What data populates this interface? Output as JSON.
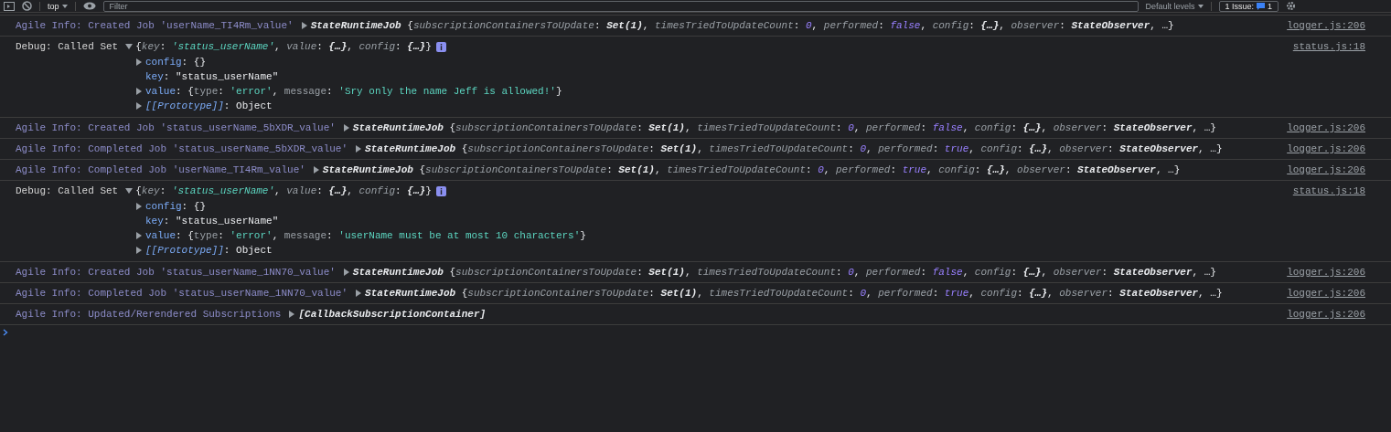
{
  "toolbar": {
    "context": "top",
    "filter_placeholder": "Filter",
    "levels": "Default levels",
    "issues_label": "1 Issue:",
    "issues_count": "1"
  },
  "messages": [
    {
      "kind": "info",
      "text": "Agile Info: Created Job 'userName_TI4Rm_value'",
      "expanded": false,
      "source": "logger.js:206",
      "preview": [
        {
          "text": "StateRuntimeJob ",
          "kind": "cls"
        },
        {
          "text": "{",
          "kind": "p"
        },
        {
          "text": "subscriptionContainersToUpdate",
          "kind": "key"
        },
        {
          "text": ": ",
          "kind": "p"
        },
        {
          "text": "Set(1)",
          "kind": "cls"
        },
        {
          "text": ", ",
          "kind": "p"
        },
        {
          "text": "timesTriedToUpdateCount",
          "kind": "key"
        },
        {
          "text": ": ",
          "kind": "p"
        },
        {
          "text": "0",
          "kind": "num"
        },
        {
          "text": ", ",
          "kind": "p"
        },
        {
          "text": "performed",
          "kind": "key"
        },
        {
          "text": ": ",
          "kind": "p"
        },
        {
          "text": "false",
          "kind": "num"
        },
        {
          "text": ", ",
          "kind": "p"
        },
        {
          "text": "config",
          "kind": "key"
        },
        {
          "text": ": ",
          "kind": "p"
        },
        {
          "text": "{…}",
          "kind": "cls"
        },
        {
          "text": ", ",
          "kind": "p"
        },
        {
          "text": "observer",
          "kind": "key"
        },
        {
          "text": ": ",
          "kind": "p"
        },
        {
          "text": "StateObserver",
          "kind": "cls"
        },
        {
          "text": ", …}",
          "kind": "p"
        }
      ]
    },
    {
      "kind": "debug",
      "text": "Debug: Called Set",
      "expanded": true,
      "source": "status.js:18",
      "preview": [
        {
          "text": "{",
          "kind": "p"
        },
        {
          "text": "key",
          "kind": "key"
        },
        {
          "text": ": ",
          "kind": "p"
        },
        {
          "text": "'status_userName'",
          "kind": "str"
        },
        {
          "text": ", ",
          "kind": "p"
        },
        {
          "text": "value",
          "kind": "key"
        },
        {
          "text": ": ",
          "kind": "p"
        },
        {
          "text": "{…}",
          "kind": "cls"
        },
        {
          "text": ", ",
          "kind": "p"
        },
        {
          "text": "config",
          "kind": "key"
        },
        {
          "text": ": ",
          "kind": "p"
        },
        {
          "text": "{…}",
          "kind": "cls"
        },
        {
          "text": "}",
          "kind": "p"
        }
      ],
      "children": [
        {
          "expanded": false,
          "tokens": [
            {
              "text": "config",
              "kind": "prop"
            },
            {
              "text": ": ",
              "kind": "p"
            },
            {
              "text": "{}",
              "kind": "p"
            }
          ]
        },
        {
          "tokens": [
            {
              "text": "key",
              "kind": "prop"
            },
            {
              "text": ": ",
              "kind": "p"
            },
            {
              "text": "\"status_userName\"",
              "kind": "p"
            }
          ]
        },
        {
          "expanded": false,
          "tokens": [
            {
              "text": "value",
              "kind": "prop"
            },
            {
              "text": ": ",
              "kind": "p"
            },
            {
              "text": "{",
              "kind": "p"
            },
            {
              "text": "type",
              "kind": "plainkey"
            },
            {
              "text": ": ",
              "kind": "p"
            },
            {
              "text": "'error'",
              "kind": "strp"
            },
            {
              "text": ", ",
              "kind": "p"
            },
            {
              "text": "message",
              "kind": "plainkey"
            },
            {
              "text": ": ",
              "kind": "p"
            },
            {
              "text": "'Sry only the name Jeff is allowed!'",
              "kind": "strp"
            },
            {
              "text": "}",
              "kind": "p"
            }
          ]
        },
        {
          "expanded": false,
          "tokens": [
            {
              "text": "[[Prototype]]",
              "kind": "proto"
            },
            {
              "text": ": ",
              "kind": "p"
            },
            {
              "text": "Object",
              "kind": "p"
            }
          ]
        }
      ]
    },
    {
      "kind": "info",
      "text": "Agile Info: Created Job 'status_userName_5bXDR_value'",
      "expanded": false,
      "source": "logger.js:206",
      "preview": [
        {
          "text": "StateRuntimeJob ",
          "kind": "cls"
        },
        {
          "text": "{",
          "kind": "p"
        },
        {
          "text": "subscriptionContainersToUpdate",
          "kind": "key"
        },
        {
          "text": ": ",
          "kind": "p"
        },
        {
          "text": "Set(1)",
          "kind": "cls"
        },
        {
          "text": ", ",
          "kind": "p"
        },
        {
          "text": "timesTriedToUpdateCount",
          "kind": "key"
        },
        {
          "text": ": ",
          "kind": "p"
        },
        {
          "text": "0",
          "kind": "num"
        },
        {
          "text": ", ",
          "kind": "p"
        },
        {
          "text": "performed",
          "kind": "key"
        },
        {
          "text": ": ",
          "kind": "p"
        },
        {
          "text": "false",
          "kind": "num"
        },
        {
          "text": ", ",
          "kind": "p"
        },
        {
          "text": "config",
          "kind": "key"
        },
        {
          "text": ": ",
          "kind": "p"
        },
        {
          "text": "{…}",
          "kind": "cls"
        },
        {
          "text": ", ",
          "kind": "p"
        },
        {
          "text": "observer",
          "kind": "key"
        },
        {
          "text": ": ",
          "kind": "p"
        },
        {
          "text": "StateObserver",
          "kind": "cls"
        },
        {
          "text": ", …}",
          "kind": "p"
        }
      ]
    },
    {
      "kind": "info",
      "text": "Agile Info: Completed Job 'status_userName_5bXDR_value'",
      "expanded": false,
      "source": "logger.js:206",
      "preview": [
        {
          "text": "StateRuntimeJob ",
          "kind": "cls"
        },
        {
          "text": "{",
          "kind": "p"
        },
        {
          "text": "subscriptionContainersToUpdate",
          "kind": "key"
        },
        {
          "text": ": ",
          "kind": "p"
        },
        {
          "text": "Set(1)",
          "kind": "cls"
        },
        {
          "text": ", ",
          "kind": "p"
        },
        {
          "text": "timesTriedToUpdateCount",
          "kind": "key"
        },
        {
          "text": ": ",
          "kind": "p"
        },
        {
          "text": "0",
          "kind": "num"
        },
        {
          "text": ", ",
          "kind": "p"
        },
        {
          "text": "performed",
          "kind": "key"
        },
        {
          "text": ": ",
          "kind": "p"
        },
        {
          "text": "true",
          "kind": "num"
        },
        {
          "text": ", ",
          "kind": "p"
        },
        {
          "text": "config",
          "kind": "key"
        },
        {
          "text": ": ",
          "kind": "p"
        },
        {
          "text": "{…}",
          "kind": "cls"
        },
        {
          "text": ", ",
          "kind": "p"
        },
        {
          "text": "observer",
          "kind": "key"
        },
        {
          "text": ": ",
          "kind": "p"
        },
        {
          "text": "StateObserver",
          "kind": "cls"
        },
        {
          "text": ", …}",
          "kind": "p"
        }
      ]
    },
    {
      "kind": "info",
      "text": "Agile Info: Completed Job 'userName_TI4Rm_value'",
      "expanded": false,
      "source": "logger.js:206",
      "preview": [
        {
          "text": "StateRuntimeJob ",
          "kind": "cls"
        },
        {
          "text": "{",
          "kind": "p"
        },
        {
          "text": "subscriptionContainersToUpdate",
          "kind": "key"
        },
        {
          "text": ": ",
          "kind": "p"
        },
        {
          "text": "Set(1)",
          "kind": "cls"
        },
        {
          "text": ", ",
          "kind": "p"
        },
        {
          "text": "timesTriedToUpdateCount",
          "kind": "key"
        },
        {
          "text": ": ",
          "kind": "p"
        },
        {
          "text": "0",
          "kind": "num"
        },
        {
          "text": ", ",
          "kind": "p"
        },
        {
          "text": "performed",
          "kind": "key"
        },
        {
          "text": ": ",
          "kind": "p"
        },
        {
          "text": "true",
          "kind": "num"
        },
        {
          "text": ", ",
          "kind": "p"
        },
        {
          "text": "config",
          "kind": "key"
        },
        {
          "text": ": ",
          "kind": "p"
        },
        {
          "text": "{…}",
          "kind": "cls"
        },
        {
          "text": ", ",
          "kind": "p"
        },
        {
          "text": "observer",
          "kind": "key"
        },
        {
          "text": ": ",
          "kind": "p"
        },
        {
          "text": "StateObserver",
          "kind": "cls"
        },
        {
          "text": ", …}",
          "kind": "p"
        }
      ]
    },
    {
      "kind": "debug",
      "text": "Debug: Called Set",
      "expanded": true,
      "source": "status.js:18",
      "preview": [
        {
          "text": "{",
          "kind": "p"
        },
        {
          "text": "key",
          "kind": "key"
        },
        {
          "text": ": ",
          "kind": "p"
        },
        {
          "text": "'status_userName'",
          "kind": "str"
        },
        {
          "text": ", ",
          "kind": "p"
        },
        {
          "text": "value",
          "kind": "key"
        },
        {
          "text": ": ",
          "kind": "p"
        },
        {
          "text": "{…}",
          "kind": "cls"
        },
        {
          "text": ", ",
          "kind": "p"
        },
        {
          "text": "config",
          "kind": "key"
        },
        {
          "text": ": ",
          "kind": "p"
        },
        {
          "text": "{…}",
          "kind": "cls"
        },
        {
          "text": "}",
          "kind": "p"
        }
      ],
      "children": [
        {
          "expanded": false,
          "tokens": [
            {
              "text": "config",
              "kind": "prop"
            },
            {
              "text": ": ",
              "kind": "p"
            },
            {
              "text": "{}",
              "kind": "p"
            }
          ]
        },
        {
          "tokens": [
            {
              "text": "key",
              "kind": "prop"
            },
            {
              "text": ": ",
              "kind": "p"
            },
            {
              "text": "\"status_userName\"",
              "kind": "p"
            }
          ]
        },
        {
          "expanded": false,
          "tokens": [
            {
              "text": "value",
              "kind": "prop"
            },
            {
              "text": ": ",
              "kind": "p"
            },
            {
              "text": "{",
              "kind": "p"
            },
            {
              "text": "type",
              "kind": "plainkey"
            },
            {
              "text": ": ",
              "kind": "p"
            },
            {
              "text": "'error'",
              "kind": "strp"
            },
            {
              "text": ", ",
              "kind": "p"
            },
            {
              "text": "message",
              "kind": "plainkey"
            },
            {
              "text": ": ",
              "kind": "p"
            },
            {
              "text": "'userName must be at most 10 characters'",
              "kind": "strp"
            },
            {
              "text": "}",
              "kind": "p"
            }
          ]
        },
        {
          "expanded": false,
          "tokens": [
            {
              "text": "[[Prototype]]",
              "kind": "proto"
            },
            {
              "text": ": ",
              "kind": "p"
            },
            {
              "text": "Object",
              "kind": "p"
            }
          ]
        }
      ]
    },
    {
      "kind": "info",
      "text": "Agile Info: Created Job 'status_userName_1NN70_value'",
      "expanded": false,
      "source": "logger.js:206",
      "preview": [
        {
          "text": "StateRuntimeJob ",
          "kind": "cls"
        },
        {
          "text": "{",
          "kind": "p"
        },
        {
          "text": "subscriptionContainersToUpdate",
          "kind": "key"
        },
        {
          "text": ": ",
          "kind": "p"
        },
        {
          "text": "Set(1)",
          "kind": "cls"
        },
        {
          "text": ", ",
          "kind": "p"
        },
        {
          "text": "timesTriedToUpdateCount",
          "kind": "key"
        },
        {
          "text": ": ",
          "kind": "p"
        },
        {
          "text": "0",
          "kind": "num"
        },
        {
          "text": ", ",
          "kind": "p"
        },
        {
          "text": "performed",
          "kind": "key"
        },
        {
          "text": ": ",
          "kind": "p"
        },
        {
          "text": "false",
          "kind": "num"
        },
        {
          "text": ", ",
          "kind": "p"
        },
        {
          "text": "config",
          "kind": "key"
        },
        {
          "text": ": ",
          "kind": "p"
        },
        {
          "text": "{…}",
          "kind": "cls"
        },
        {
          "text": ", ",
          "kind": "p"
        },
        {
          "text": "observer",
          "kind": "key"
        },
        {
          "text": ": ",
          "kind": "p"
        },
        {
          "text": "StateObserver",
          "kind": "cls"
        },
        {
          "text": ", …}",
          "kind": "p"
        }
      ]
    },
    {
      "kind": "info",
      "text": "Agile Info: Completed Job 'status_userName_1NN70_value'",
      "expanded": false,
      "source": "logger.js:206",
      "preview": [
        {
          "text": "StateRuntimeJob ",
          "kind": "cls"
        },
        {
          "text": "{",
          "kind": "p"
        },
        {
          "text": "subscriptionContainersToUpdate",
          "kind": "key"
        },
        {
          "text": ": ",
          "kind": "p"
        },
        {
          "text": "Set(1)",
          "kind": "cls"
        },
        {
          "text": ", ",
          "kind": "p"
        },
        {
          "text": "timesTriedToUpdateCount",
          "kind": "key"
        },
        {
          "text": ": ",
          "kind": "p"
        },
        {
          "text": "0",
          "kind": "num"
        },
        {
          "text": ", ",
          "kind": "p"
        },
        {
          "text": "performed",
          "kind": "key"
        },
        {
          "text": ": ",
          "kind": "p"
        },
        {
          "text": "true",
          "kind": "num"
        },
        {
          "text": ", ",
          "kind": "p"
        },
        {
          "text": "config",
          "kind": "key"
        },
        {
          "text": ": ",
          "kind": "p"
        },
        {
          "text": "{…}",
          "kind": "cls"
        },
        {
          "text": ", ",
          "kind": "p"
        },
        {
          "text": "observer",
          "kind": "key"
        },
        {
          "text": ": ",
          "kind": "p"
        },
        {
          "text": "StateObserver",
          "kind": "cls"
        },
        {
          "text": ", …}",
          "kind": "p"
        }
      ]
    },
    {
      "kind": "info",
      "text": "Agile Info: Updated/Rerendered Subscriptions",
      "expanded": false,
      "source": "logger.js:206",
      "preview": [
        {
          "text": "[CallbackSubscriptionContainer]",
          "kind": "cls"
        }
      ]
    }
  ]
}
